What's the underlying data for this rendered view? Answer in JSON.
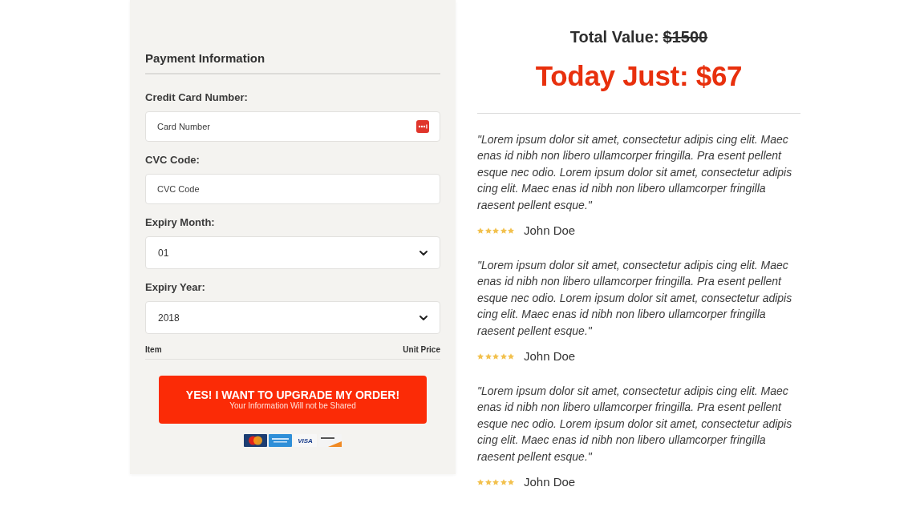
{
  "payment_form": {
    "title": "Payment Information",
    "fields": [
      {
        "kind": "card",
        "label": "Credit Card Number:",
        "placeholder": "Card Number"
      },
      {
        "kind": "text",
        "label": "CVC Code:",
        "placeholder": "CVC Code"
      },
      {
        "kind": "select",
        "label": "Expiry Month:",
        "value": "01"
      },
      {
        "kind": "select",
        "label": "Expiry Year:",
        "value": "2018"
      }
    ],
    "order_table": {
      "columns": [
        "Item",
        "Unit Price"
      ]
    },
    "submit_button": {
      "label": "YES! I WANT TO UPGRADE MY ORDER!",
      "note": "Your Information Will not be Shared"
    },
    "card_logos": [
      {
        "kind": "mastercard"
      },
      {
        "kind": "amex"
      },
      {
        "kind": "visa",
        "label": "VISA"
      },
      {
        "kind": "discover"
      }
    ]
  },
  "offer": {
    "total_label": "Total Value:",
    "total_amount": "$1500",
    "total_struck": true,
    "price": "Today Just: $67"
  },
  "testimonials": [
    {
      "quote": "\"Lorem ipsum dolor sit amet, consectetur adipis cing elit. Maec enas id nibh non libero ullamcorper fringilla. Pra esent pellent esque nec odio. Lorem ipsum dolor sit amet, consectetur adipis cing elit. Maec enas id nibh non libero ullamcorper fringilla raesent pellent esque.\"",
      "stars": 5,
      "name": "John Doe"
    },
    {
      "quote": "\"Lorem ipsum dolor sit amet, consectetur adipis cing elit. Maec enas id nibh non libero ullamcorper fringilla. Pra esent pellent esque nec odio. Lorem ipsum dolor sit amet, consectetur adipis cing elit. Maec enas id nibh non libero ullamcorper fringilla raesent pellent esque.\"",
      "stars": 5,
      "name": "John Doe"
    },
    {
      "quote": "\"Lorem ipsum dolor sit amet, consectetur adipis cing elit. Maec enas id nibh non libero ullamcorper fringilla. Pra esent pellent esque nec odio. Lorem ipsum dolor sit amet, consectetur adipis cing elit. Maec enas id nibh non libero ullamcorper fringilla raesent pellent esque.\"",
      "stars": 5,
      "name": "John Doe"
    }
  ]
}
